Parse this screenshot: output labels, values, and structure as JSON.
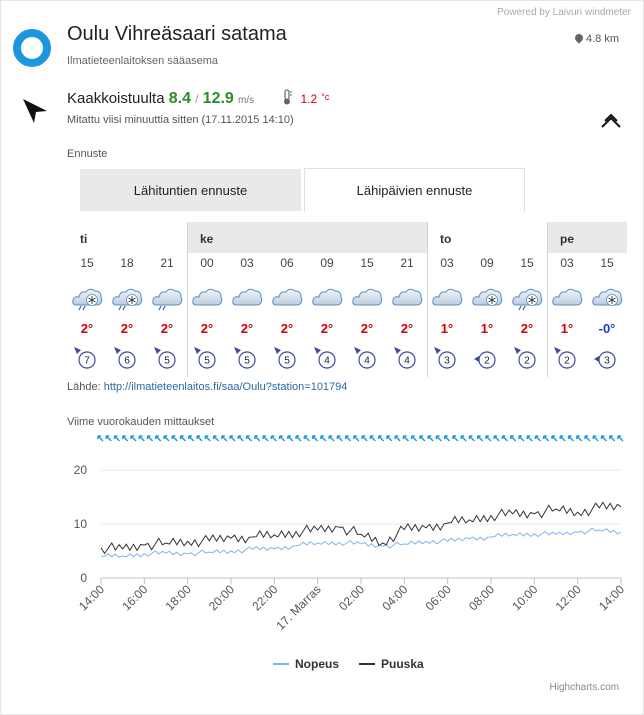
{
  "header": {
    "powered_by": "Powered by Laivuri windmeter",
    "title": "Oulu Vihreäsaari satama",
    "subtitle": "Ilmatieteenlaitoksen sääasema",
    "distance": "4.8 km"
  },
  "current": {
    "direction_text": "Kaakkoistuulta",
    "wind_speed": "8.4",
    "separator": "/",
    "gust_speed": "12.9",
    "wind_unit": "m/s",
    "temperature": "1.2",
    "temp_unit": "°c",
    "measured": "Mitattu viisi minuuttia sitten (17.11.2015 14:10)"
  },
  "forecast": {
    "label": "Ennuste",
    "tabs": [
      {
        "label": "Lähituntien ennuste",
        "active": false
      },
      {
        "label": "Lähipäivien ennuste",
        "active": true
      }
    ],
    "days": [
      {
        "day": "ti",
        "shaded": false,
        "slots": [
          {
            "hour": "15",
            "temp": "2°",
            "wind": "7",
            "icon": "cloud-snow-rain",
            "dir": "nw"
          },
          {
            "hour": "18",
            "temp": "2°",
            "wind": "6",
            "icon": "cloud-snow-rain",
            "dir": "nw"
          },
          {
            "hour": "21",
            "temp": "2°",
            "wind": "5",
            "icon": "cloud-rain",
            "dir": "nw"
          }
        ]
      },
      {
        "day": "ke",
        "shaded": true,
        "slots": [
          {
            "hour": "00",
            "temp": "2°",
            "wind": "5",
            "icon": "cloud",
            "dir": "nw"
          },
          {
            "hour": "03",
            "temp": "2°",
            "wind": "5",
            "icon": "cloud",
            "dir": "nw"
          },
          {
            "hour": "06",
            "temp": "2°",
            "wind": "5",
            "icon": "cloud",
            "dir": "nw"
          },
          {
            "hour": "09",
            "temp": "2°",
            "wind": "4",
            "icon": "cloud",
            "dir": "nw"
          },
          {
            "hour": "15",
            "temp": "2°",
            "wind": "4",
            "icon": "cloud",
            "dir": "nw"
          },
          {
            "hour": "21",
            "temp": "2°",
            "wind": "4",
            "icon": "cloud",
            "dir": "nw"
          }
        ]
      },
      {
        "day": "to",
        "shaded": false,
        "slots": [
          {
            "hour": "03",
            "temp": "1°",
            "wind": "3",
            "icon": "cloud",
            "dir": "nw"
          },
          {
            "hour": "09",
            "temp": "1°",
            "wind": "2",
            "icon": "cloud-snow",
            "dir": "w"
          },
          {
            "hour": "15",
            "temp": "2°",
            "wind": "2",
            "icon": "cloud-snow-rain",
            "dir": "nw"
          }
        ]
      },
      {
        "day": "pe",
        "shaded": true,
        "slots": [
          {
            "hour": "03",
            "temp": "1°",
            "wind": "2",
            "icon": "cloud",
            "dir": "nw"
          },
          {
            "hour": "15",
            "temp": "-0°",
            "wind": "3",
            "icon": "cloud-snow",
            "dir": "w"
          }
        ]
      }
    ],
    "source_label": "Lähde:",
    "source_url": "http://ilmatieteenlaitos.fi/saa/Oulu?station=101794"
  },
  "history": {
    "title": "Viime vuorokauden mittaukset",
    "credits": "Highcharts.com"
  },
  "colors": {
    "accent": "#1e96db",
    "speed_line": "#7cb5ec",
    "gust_line": "#333333",
    "wind_num": "#2e8b2e",
    "temp_warm": "#d40000",
    "temp_cold": "#1a3fd0",
    "dir_icon": "#3b4a9e"
  },
  "chart_data": {
    "type": "line",
    "title": "Viime vuorokauden mittaukset",
    "xlabel": "",
    "ylabel": "",
    "ylim": [
      0,
      23
    ],
    "yticks": [
      0,
      10,
      20
    ],
    "x_tick_labels": [
      "14:00",
      "16:00",
      "18:00",
      "20:00",
      "22:00",
      "17. Marras",
      "02:00",
      "04:00",
      "06:00",
      "08:00",
      "10:00",
      "12:00",
      "14:00"
    ],
    "x_hours": [
      0,
      1,
      2,
      3,
      4,
      5,
      6,
      7,
      8,
      9,
      10,
      11,
      12,
      13,
      14,
      15,
      16,
      17,
      18,
      19,
      20,
      21,
      22,
      23,
      24
    ],
    "legend_position": "bottom",
    "series": [
      {
        "name": "Nopeus",
        "values": [
          4.0,
          4.1,
          4.5,
          4.6,
          4.5,
          4.8,
          5.0,
          5.3,
          5.4,
          6.0,
          6.5,
          6.6,
          6.3,
          5.9,
          6.3,
          6.8,
          6.8,
          7.3,
          7.6,
          8.1,
          8.2,
          8.1,
          8.5,
          8.9,
          8.5
        ]
      },
      {
        "name": "Puuska",
        "values": [
          5.6,
          5.4,
          6.1,
          6.5,
          6.8,
          6.9,
          7.4,
          7.6,
          8.0,
          8.6,
          8.9,
          9.4,
          8.1,
          6.5,
          9.0,
          9.3,
          10.2,
          10.8,
          11.6,
          11.9,
          11.9,
          12.8,
          12.2,
          13.0,
          13.2
        ]
      }
    ],
    "direction_row_glyph": "wind-arrow-se"
  }
}
